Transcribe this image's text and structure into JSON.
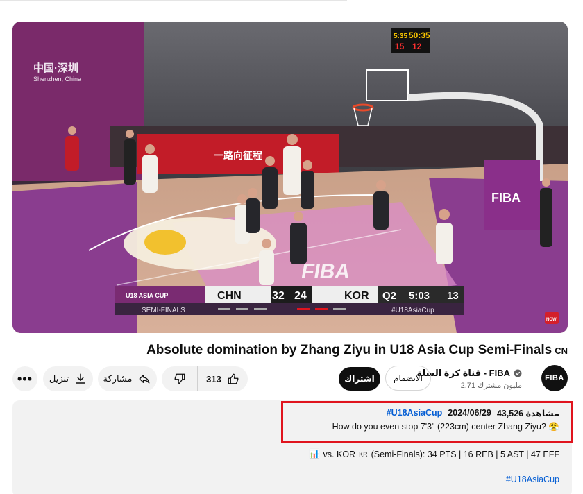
{
  "player": {
    "overlay_city_cn": "中国·深圳",
    "overlay_city_en": "Shenzhen, China",
    "banner_text": "一路向征程",
    "court_logo": "FIBA",
    "shot_clock_left": "5:35",
    "shot_clock_right": "50:35",
    "jersey_left": "15",
    "jersey_right": "12",
    "live_badge": "NOW",
    "scoreboard": {
      "event_logo": "U18 ASIA CUP",
      "team1": "CHN",
      "score1": "32",
      "score2": "24",
      "team2": "KOR",
      "period": "Q2",
      "clock": "5:03",
      "shot_clock": "13",
      "stage": "SEMI-FINALS",
      "hashtag": "#U18AsiaCup"
    },
    "accent_red": "#c8102e",
    "court_purple": "#8a3d8f"
  },
  "video": {
    "title": "Absolute domination by Zhang Ziyu in U18 Asia Cup Semi-Finals",
    "title_suffix": "CN"
  },
  "actions": {
    "more_label": "•••",
    "download_label": "تنزيل",
    "share_label": "مشاركة",
    "like_count": "313"
  },
  "channel": {
    "name": "قناة كرة السلة - FIBA",
    "subscribers": "2.71 مليون مشترك",
    "avatar_text": "FIBA",
    "subscribe_label": "اشتراك",
    "join_label": "الانضمام"
  },
  "description": {
    "views": "43,526 مشاهدة",
    "date": "2024/06/29",
    "hashtag": "#U18AsiaCup",
    "line1": "How do you even stop 7'3\" (223cm) center Zhang Ziyu? 😤",
    "line2_emoji": "📊",
    "line2_prefix": "vs. KOR",
    "line2_flag": "KR",
    "line2_stats": "(Semi-Finals): 34 PTS | 16 REB | 5 AST | 47 EFF",
    "footer_tag": "#U18AsiaCup"
  }
}
